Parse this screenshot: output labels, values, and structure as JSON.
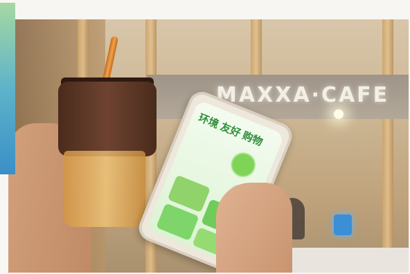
{
  "photo": {
    "storefront_sign": "MAXXA·CAFE",
    "phone_screen_title": "环境 友好 购物"
  },
  "accent": {
    "gradient_top": "#a6d8a2",
    "gradient_bottom": "#3a8fc7"
  },
  "icons": [
    "cup-icon",
    "phone-icon"
  ]
}
